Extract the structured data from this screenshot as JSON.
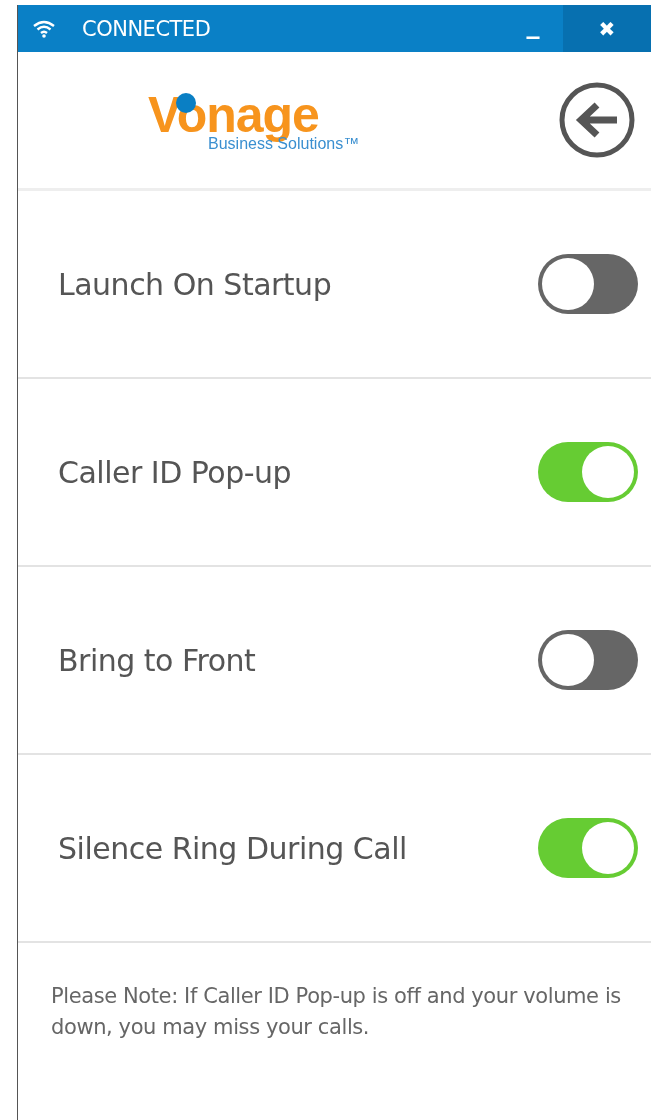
{
  "title_bar": {
    "status": "CONNECTED",
    "minimize": "_",
    "close": "✖"
  },
  "logo": {
    "name": "Vonage",
    "tagline": "Business Solutions™"
  },
  "settings": [
    {
      "label": "Launch On Startup",
      "on": false
    },
    {
      "label": "Caller ID Pop-up",
      "on": true
    },
    {
      "label": "Bring to Front",
      "on": false
    },
    {
      "label": "Silence Ring During Call",
      "on": true
    }
  ],
  "note": "Please Note: If Caller ID Pop-up is off and your volume is down, you may miss your calls."
}
